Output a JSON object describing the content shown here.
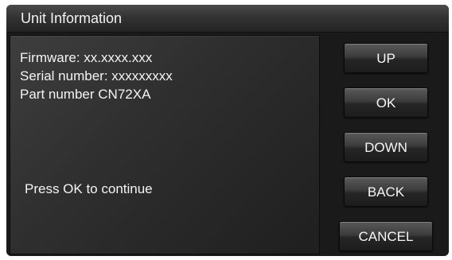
{
  "window": {
    "title": "Unit Information"
  },
  "info": {
    "firmware": "Firmware: xx.xxxx.xxx",
    "serial": "Serial number: xxxxxxxxx",
    "part": "Part number CN72XA",
    "prompt": "Press OK to continue"
  },
  "buttons": {
    "up": "UP",
    "ok": "OK",
    "down": "DOWN",
    "back": "BACK",
    "cancel": "CANCEL"
  },
  "colors": {
    "background": "#1a1a1a",
    "text": "#f4f4f4",
    "button_top": "#5a5a5a",
    "button_bottom": "#1c1c1c"
  }
}
